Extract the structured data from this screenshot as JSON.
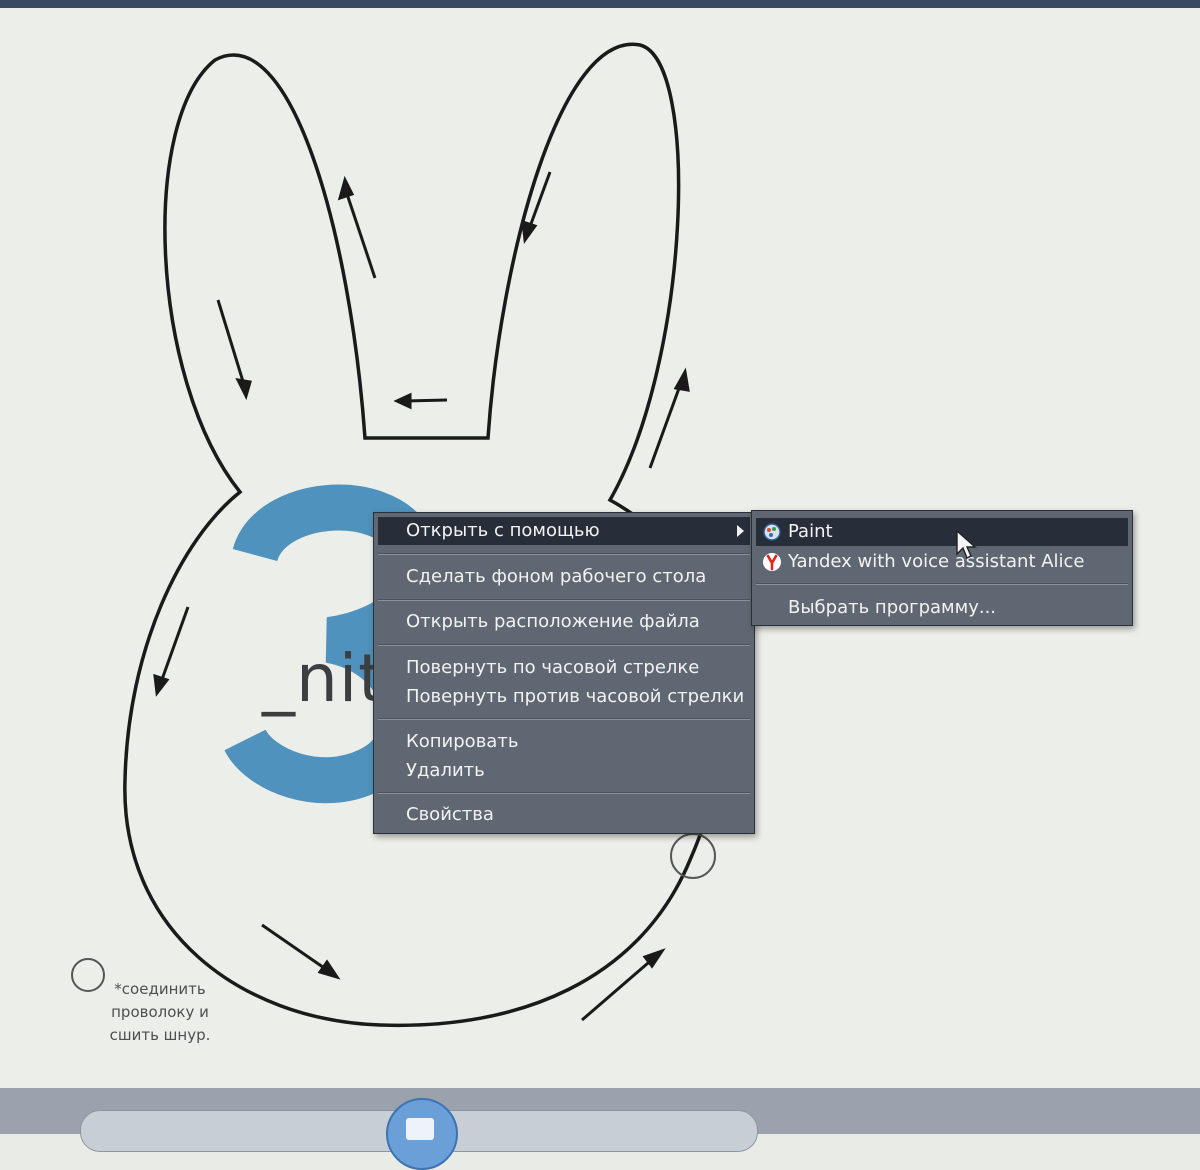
{
  "context_menu": {
    "items": [
      {
        "label": "Открыть с помощью",
        "has_submenu": true,
        "highlighted": true
      },
      {
        "label": "Сделать фоном рабочего стола"
      },
      {
        "label": "Открыть расположение файла"
      },
      {
        "label": "Повернуть по часовой стрелке"
      },
      {
        "label": "Повернуть против часовой стрелки"
      },
      {
        "label": "Копировать"
      },
      {
        "label": "Удалить"
      },
      {
        "label": "Свойства"
      }
    ]
  },
  "submenu": {
    "items": [
      {
        "label": "Paint",
        "icon": "paint-icon",
        "highlighted": true
      },
      {
        "label": "Yandex with voice assistant Alice",
        "icon": "yandex-browser-icon"
      },
      {
        "label": "Выбрать программу..."
      }
    ]
  },
  "image_content": {
    "logo_text": "_nit",
    "logo_numeral": "3",
    "note_lines": [
      "*соединить",
      "проволоку и",
      "сшить шнур."
    ]
  },
  "colors": {
    "menu_bg": "#5f6872",
    "menu_highlight": "#272e3a",
    "logo_blue": "#3d87b8",
    "outline": "#1a1a1a"
  }
}
